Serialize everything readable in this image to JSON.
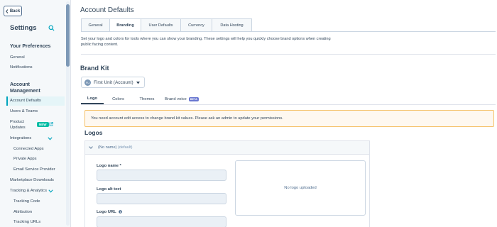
{
  "sidebar": {
    "back_label": "Back",
    "title": "Settings",
    "your_preferences": {
      "header": "Your Preferences",
      "items": [
        "General",
        "Notifications"
      ]
    },
    "account_management": {
      "header": "Account Management",
      "account_defaults": "Account Defaults",
      "users_teams": "Users & Teams",
      "product_updates_line1": "Product",
      "product_updates_line2": "Updates",
      "new_badge": "NEW",
      "integrations": "Integrations",
      "integration_items": [
        "Connected Apps",
        "Private Apps",
        "Email Service Provider"
      ],
      "marketplace_downloads": "Marketplace Downloads",
      "tracking_analytics": "Tracking & Analytics",
      "tracking_items": [
        "Tracking Code",
        "Attribution",
        "Tracking URLs"
      ]
    }
  },
  "page": {
    "title": "Account Defaults",
    "tabs": [
      "General",
      "Branding",
      "User Defaults",
      "Currency",
      "Data Hosting"
    ],
    "active_tab": "Branding",
    "description": "Set your logo and colors for tools where you can show your branding. These settings will help you quickly choose brand options when creating public facing content."
  },
  "brand_kit": {
    "title": "Brand Kit",
    "unit_avatar": "FU",
    "unit_selected": "First Unit (Account)",
    "subtabs": [
      "Logo",
      "Colors",
      "Themes",
      "Brand voice"
    ],
    "beta_badge": "BETA",
    "alert": "You need account edit access to change brand kit values. Please ask an admin to update your permissions."
  },
  "logos": {
    "title": "Logos",
    "accordion_name": "(No name)",
    "accordion_default": "(default)",
    "logo_name_label": "Logo name *",
    "logo_alt_label": "Logo alt text",
    "logo_url_label": "Logo URL",
    "no_logo": "No logo uploaded"
  },
  "colors": {
    "accent": "#00a4bd",
    "new_badge": "#00bda5",
    "beta_badge": "#6a78d1",
    "alert_border": "#f5c26b",
    "text": "#33475b"
  }
}
